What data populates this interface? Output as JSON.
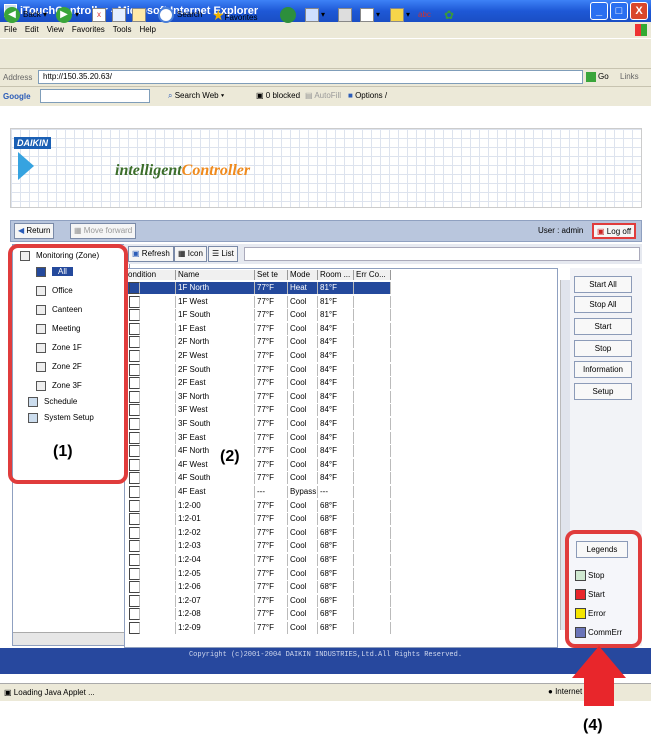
{
  "window": {
    "title": "iTouchController - Microsoft Internet Explorer",
    "min": "_",
    "max": "□",
    "close": "X"
  },
  "menu": [
    "File",
    "Edit",
    "View",
    "Favorites",
    "Tools",
    "Help"
  ],
  "toolbar": {
    "back": "Back",
    "search": "Search",
    "favorites": "Favorites"
  },
  "address": {
    "label": "Address",
    "url": "http://150.35.20.63/",
    "go": "Go",
    "links": "Links"
  },
  "google": {
    "label": "Google",
    "search_web": "Search Web",
    "blocked": "0 blocked",
    "autofill": "AutoFill",
    "options": "Options"
  },
  "banner": {
    "logo": "DAIKIN",
    "brand_prefix": "intelligent",
    "brand_suffix": "Controller"
  },
  "appbar": {
    "return": "Return",
    "move_forward": "Move forward",
    "user": "User : admin",
    "logoff": "Log off"
  },
  "tree": {
    "root": "Monitoring (Zone)",
    "zones": [
      "All",
      "Office",
      "Canteen",
      "Meeting",
      "Zone 1F",
      "Zone 2F",
      "Zone 3F"
    ],
    "schedule": "Schedule",
    "setup": "System Setup"
  },
  "subtool": {
    "refresh": "Refresh",
    "icon": "Icon",
    "list": "List"
  },
  "grid": {
    "headers": [
      "ondition",
      "Name",
      "Set te",
      "Mode",
      "Room ...",
      "Err Co..."
    ],
    "rows": [
      {
        "name": "1F North",
        "set": "77°F",
        "mode": "Heat",
        "room": "81°F",
        "selected": true
      },
      {
        "name": "1F West",
        "set": "77°F",
        "mode": "Cool",
        "room": "81°F"
      },
      {
        "name": "1F South",
        "set": "77°F",
        "mode": "Cool",
        "room": "81°F"
      },
      {
        "name": "1F East",
        "set": "77°F",
        "mode": "Cool",
        "room": "84°F"
      },
      {
        "name": "2F North",
        "set": "77°F",
        "mode": "Cool",
        "room": "84°F"
      },
      {
        "name": "2F West",
        "set": "77°F",
        "mode": "Cool",
        "room": "84°F"
      },
      {
        "name": "2F South",
        "set": "77°F",
        "mode": "Cool",
        "room": "84°F"
      },
      {
        "name": "2F East",
        "set": "77°F",
        "mode": "Cool",
        "room": "84°F"
      },
      {
        "name": "3F North",
        "set": "77°F",
        "mode": "Cool",
        "room": "84°F"
      },
      {
        "name": "3F West",
        "set": "77°F",
        "mode": "Cool",
        "room": "84°F"
      },
      {
        "name": "3F South",
        "set": "77°F",
        "mode": "Cool",
        "room": "84°F"
      },
      {
        "name": "3F East",
        "set": "77°F",
        "mode": "Cool",
        "room": "84°F"
      },
      {
        "name": "4F North",
        "set": "77°F",
        "mode": "Cool",
        "room": "84°F"
      },
      {
        "name": "4F West",
        "set": "77°F",
        "mode": "Cool",
        "room": "84°F"
      },
      {
        "name": "4F South",
        "set": "77°F",
        "mode": "Cool",
        "room": "84°F"
      },
      {
        "name": "4F East",
        "set": "---",
        "mode": "Bypass",
        "room": "---"
      },
      {
        "name": "1:2-00",
        "set": "77°F",
        "mode": "Cool",
        "room": "68°F"
      },
      {
        "name": "1:2-01",
        "set": "77°F",
        "mode": "Cool",
        "room": "68°F"
      },
      {
        "name": "1:2-02",
        "set": "77°F",
        "mode": "Cool",
        "room": "68°F"
      },
      {
        "name": "1:2-03",
        "set": "77°F",
        "mode": "Cool",
        "room": "68°F"
      },
      {
        "name": "1:2-04",
        "set": "77°F",
        "mode": "Cool",
        "room": "68°F"
      },
      {
        "name": "1:2-05",
        "set": "77°F",
        "mode": "Cool",
        "room": "68°F"
      },
      {
        "name": "1:2-06",
        "set": "77°F",
        "mode": "Cool",
        "room": "68°F"
      },
      {
        "name": "1:2-07",
        "set": "77°F",
        "mode": "Cool",
        "room": "68°F"
      },
      {
        "name": "1:2-08",
        "set": "77°F",
        "mode": "Cool",
        "room": "68°F"
      },
      {
        "name": "1:2-09",
        "set": "77°F",
        "mode": "Cool",
        "room": "68°F"
      }
    ]
  },
  "actions": [
    "Start All",
    "Stop All",
    "Start",
    "Stop",
    "Information",
    "Setup"
  ],
  "legend": {
    "title": "Legends",
    "items": [
      {
        "label": "Stop",
        "color": "#cfe8d0"
      },
      {
        "label": "Start",
        "color": "#e8262b"
      },
      {
        "label": "Error",
        "color": "#f5e600"
      },
      {
        "label": "CommErr",
        "color": "#6a74b8"
      }
    ]
  },
  "footer": "Copyright (c)2001-2004 DAIKIN INDUSTRIES,Ltd.All Rights Reserved.",
  "status": {
    "text": "Loading Java Applet ...",
    "zone": "Internet"
  },
  "callouts": {
    "one": "(1)",
    "two": "(2)",
    "four": "(4)"
  }
}
